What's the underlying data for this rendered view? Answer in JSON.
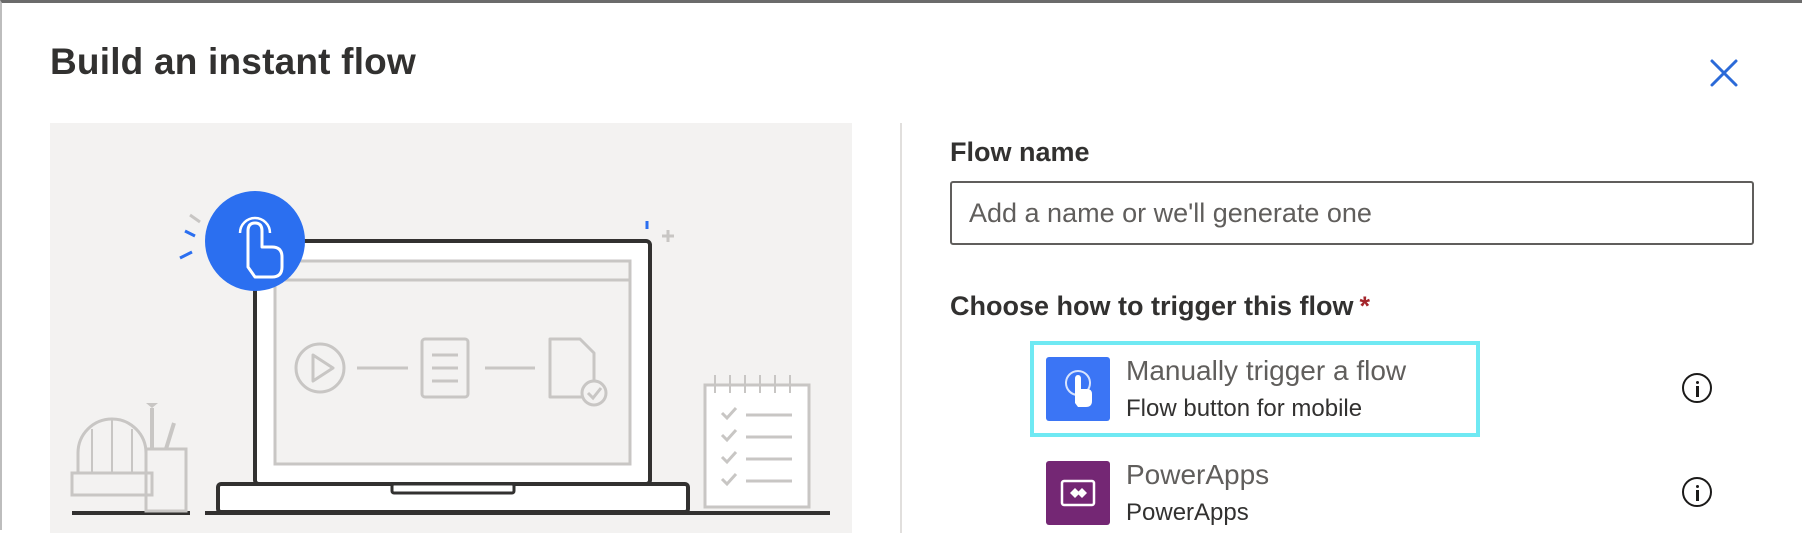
{
  "dialog": {
    "title": "Build an instant flow"
  },
  "form": {
    "flow_name_label": "Flow name",
    "flow_name_placeholder": "Add a name or we'll generate one",
    "flow_name_value": "",
    "trigger_label": "Choose how to trigger this flow",
    "required_marker": "*"
  },
  "triggers": [
    {
      "title": "Manually trigger a flow",
      "subtitle": "Flow button for mobile",
      "selected": true,
      "color": "#3b75f5",
      "icon": "touch-icon"
    },
    {
      "title": "PowerApps",
      "subtitle": "PowerApps",
      "selected": false,
      "color": "#742774",
      "icon": "powerapps-icon"
    }
  ],
  "colors": {
    "accent": "#2b6ad8",
    "selection_outline": "#6fe9f3",
    "required": "#a4262c"
  }
}
